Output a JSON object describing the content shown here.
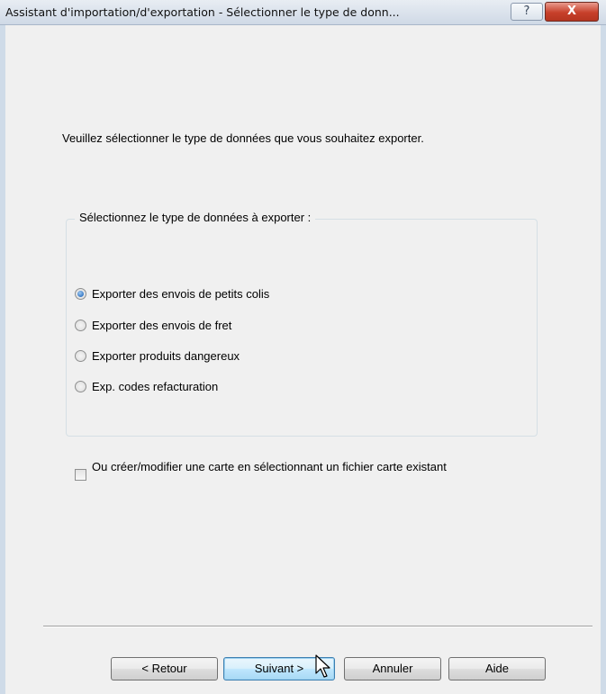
{
  "window": {
    "title": "Assistant d'importation/d'exportation - Sélectionner le type de donn...",
    "help_label": "?",
    "close_label": "X"
  },
  "instruction": "Veuillez sélectionner le type de données que vous souhaitez exporter.",
  "group": {
    "legend": "Sélectionnez le type de données à exporter :",
    "options": [
      {
        "label": "Exporter des envois de petits colis",
        "checked": true
      },
      {
        "label": "Exporter des envois de fret",
        "checked": false
      },
      {
        "label": "Exporter produits dangereux",
        "checked": false
      },
      {
        "label": "Exp. codes refacturation",
        "checked": false
      }
    ]
  },
  "checkbox": {
    "label": "Ou créer/modifier une carte en sélectionnant un fichier carte existant",
    "checked": false
  },
  "buttons": {
    "back": "< Retour",
    "next": "Suivant >",
    "cancel": "Annuler",
    "help": "Aide"
  }
}
